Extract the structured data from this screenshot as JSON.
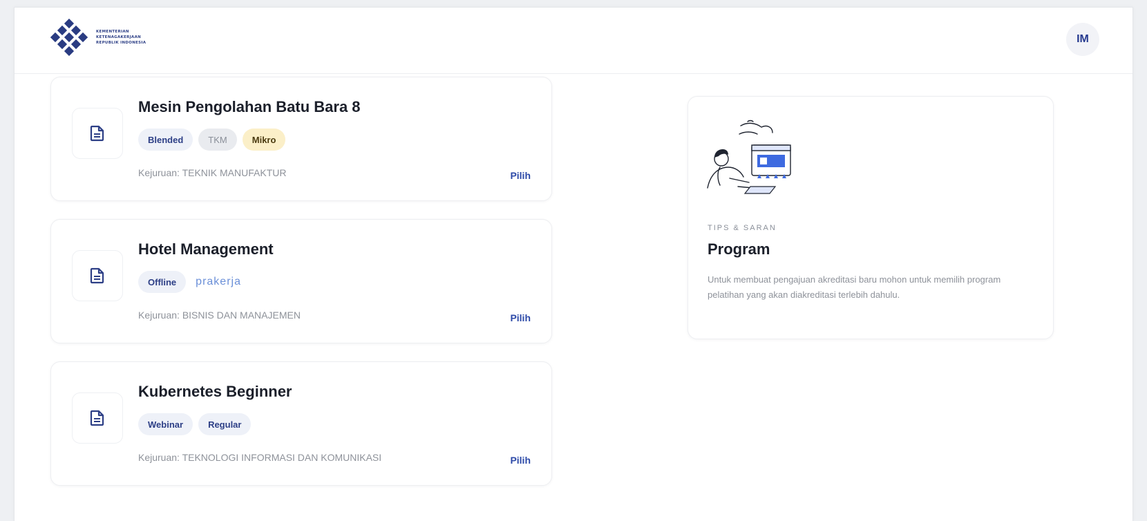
{
  "header": {
    "logo_lines": [
      "KEMENTERIAN",
      "KETENAGAKERJAAN",
      "REPUBLIK INDONESIA"
    ],
    "avatar_initials": "IM"
  },
  "programs": [
    {
      "title": "Mesin Pengolahan Batu Bara 8",
      "tags": [
        "Blended",
        "TKM",
        "Mikro"
      ],
      "kejuruan": "Kejuruan: TEKNIK MANUFAKTUR",
      "action": "Pilih"
    },
    {
      "title": "Hotel Management",
      "tags": [
        "Offline",
        "prakerja"
      ],
      "kejuruan": "Kejuruan: BISNIS DAN MANAJEMEN",
      "action": "Pilih"
    },
    {
      "title": "Kubernetes Beginner",
      "tags": [
        "Webinar",
        "Regular"
      ],
      "kejuruan": "Kejuruan: TEKNOLOGI INFORMASI DAN KOMUNIKASI",
      "action": "Pilih"
    }
  ],
  "tips": {
    "eyebrow": "TIPS & SARAN",
    "heading": "Program",
    "body": "Untuk membuat pengajuan akreditasi baru mohon untuk memilih program pelatihan yang akan diakreditasi terlebih dahulu."
  },
  "icons": {
    "logo": "kemnaker-logo-icon",
    "program": "document-icon",
    "illustration": "person-at-screen-illustration"
  },
  "colors": {
    "primary": "#2d3f86",
    "link": "#2d4aa8",
    "tag_blue_bg": "#eef1f8",
    "tag_gray_bg": "#e9ebef",
    "tag_yellow_bg": "#fbefc8"
  }
}
